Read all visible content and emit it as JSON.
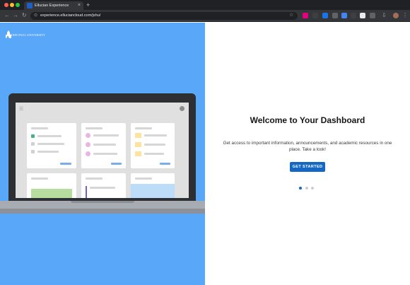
{
  "browser": {
    "tab_title": "Ellucian Experience",
    "tab_close": "×",
    "new_tab": "+",
    "url": "experience.elluciancloud.com/jshu/",
    "nav": {
      "back": "←",
      "forward": "→",
      "reload": "↻"
    },
    "site_info_icon": "⊙",
    "bookmark_star": "☆",
    "download_icon": "⇩",
    "menu_icon": "⋮"
  },
  "logo": {
    "text": "JOHN PAUL UNIVERSITY"
  },
  "illustration": {
    "menu_icon": "☰"
  },
  "welcome": {
    "title": "Welcome to Your Dashboard",
    "body": "Get access to important information, announcements, and academic resources in one place. Take a look!",
    "cta_label": "GET STARTED",
    "pager": {
      "count": 3,
      "active_index": 0
    }
  },
  "colors": {
    "panel_blue": "#59a7f9",
    "cta_blue": "#1468c4",
    "laptop_dark": "#2d2f33"
  }
}
